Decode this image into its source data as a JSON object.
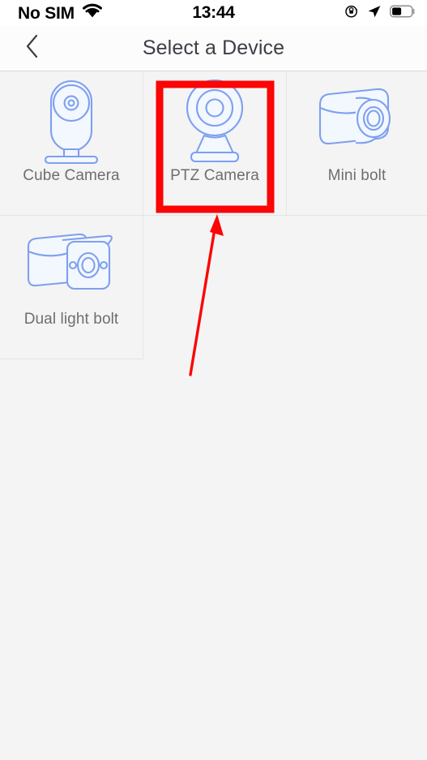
{
  "status_bar": {
    "carrier": "No SIM",
    "time": "13:44",
    "icons": {
      "wifi": "wifi-icon",
      "rotation_lock": "rotation-lock-icon",
      "location": "location-arrow-icon",
      "battery": "battery-icon"
    }
  },
  "nav_bar": {
    "back_icon": "chevron-left-icon",
    "title": "Select a Device"
  },
  "device_grid": {
    "devices": [
      {
        "label": "Cube Camera",
        "icon": "cube-camera-icon",
        "selected": false
      },
      {
        "label": "PTZ Camera",
        "icon": "ptz-camera-icon",
        "selected": true
      },
      {
        "label": "Mini bolt",
        "icon": "mini-bolt-camera-icon",
        "selected": false
      },
      {
        "label": "Dual light bolt",
        "icon": "dual-light-bolt-camera-icon",
        "selected": false
      }
    ]
  },
  "annotations": {
    "highlight_color": "#fb0505",
    "highlight_target": "PTZ Camera",
    "arrow_color": "#fb0505"
  },
  "colors": {
    "page_background": "#f4f4f4",
    "nav_background": "#fcfcfc",
    "icon_stroke": "#7da0ef",
    "icon_fill": "#f3f7fe",
    "label_text": "#6e6e6e",
    "title_text": "#3b3f45"
  }
}
